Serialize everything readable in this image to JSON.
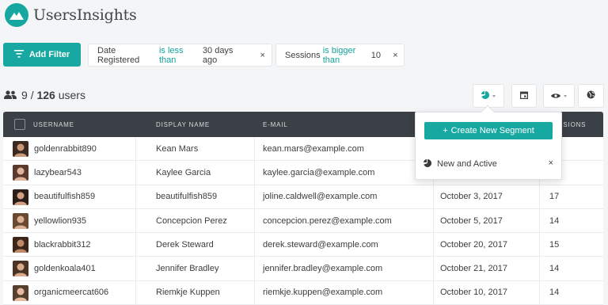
{
  "app": {
    "name": "UsersInsights"
  },
  "filters": {
    "add_label": "Add Filter",
    "chips": [
      {
        "field": "Date Registered",
        "operator": "is less than",
        "value": "30 days ago",
        "remove": "×"
      },
      {
        "field": "Sessions",
        "operator": "is bigger than",
        "value": "10",
        "remove": "×"
      }
    ]
  },
  "summary": {
    "shown": "9",
    "separator": "/",
    "total": "126",
    "unit": "users"
  },
  "table": {
    "columns": [
      "USERNAME",
      "DISPLAY NAME",
      "E-MAIL",
      "SESSIONS"
    ],
    "rows": [
      {
        "username": "goldenrabbit890",
        "display": "Kean Mars",
        "email": "kean.mars@example.com",
        "date": "",
        "sessions": ""
      },
      {
        "username": "lazybear543",
        "display": "Kaylee Garcia",
        "email": "kaylee.garcia@example.com",
        "date": "",
        "sessions": ""
      },
      {
        "username": "beautifulfish859",
        "display": "beautifulfish859",
        "email": "joline.caldwell@example.com",
        "date": "October 3, 2017",
        "sessions": "17"
      },
      {
        "username": "yellowlion935",
        "display": "Concepcion Perez",
        "email": "concepcion.perez@example.com",
        "date": "October 5, 2017",
        "sessions": "14"
      },
      {
        "username": "blackrabbit312",
        "display": "Derek Steward",
        "email": "derek.steward@example.com",
        "date": "October 20, 2017",
        "sessions": "15"
      },
      {
        "username": "goldenkoala401",
        "display": "Jennifer Bradley",
        "email": "jennifer.bradley@example.com",
        "date": "October 21, 2017",
        "sessions": "14"
      },
      {
        "username": "organicmeercat606",
        "display": "Riemkje Kuppen",
        "email": "riemkje.kuppen@example.com",
        "date": "October 10, 2017",
        "sessions": "14"
      }
    ]
  },
  "segments": {
    "create_label": "Create New Segment",
    "create_prefix": "+",
    "items": [
      {
        "label": "New and Active",
        "remove": "×"
      }
    ]
  },
  "colors": {
    "accent": "#17a9a1",
    "header_bg": "#3b4046"
  },
  "icons": [
    "logo-mountain-icon",
    "filter-icon",
    "users-icon",
    "segment-pie-icon",
    "calendar-icon",
    "eye-icon",
    "globe-icon"
  ]
}
